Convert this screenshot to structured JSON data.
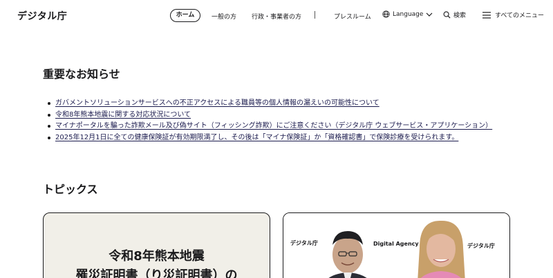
{
  "header": {
    "logo": "デジタル庁",
    "nav": {
      "home": "ホーム",
      "general": "一般の方",
      "admin": "行政・事業者の方",
      "press": "プレスルーム",
      "language": "Language",
      "search": "検索",
      "menu": "すべてのメニュー"
    }
  },
  "notices": {
    "title": "重要なお知らせ",
    "items": [
      "ガバメントソリューションサービスへの不正アクセスによる職員等の個人情報の漏えいの可能性について",
      "令和8年熊本地震に関する対応状況について",
      "マイナポータルを騙った詐欺メール及び偽サイト（フィッシング詐欺）にご注意ください（デジタル庁 ウェブサービス・アプリケーション）",
      "2025年12月1日に全ての健康保険証が有効期限満了し、その後は「マイナ保険証」か「資格確認書」で保険診療を受けられます。"
    ]
  },
  "topics": {
    "title": "トピックス",
    "card1": {
      "line1": "令和8年熊本地震",
      "line2": "罹災証明書（り災証明書）の"
    },
    "card2": {
      "logo_left": "デジタル庁",
      "agency": "Digital Agency",
      "logo_right": "デジタル庁"
    }
  }
}
